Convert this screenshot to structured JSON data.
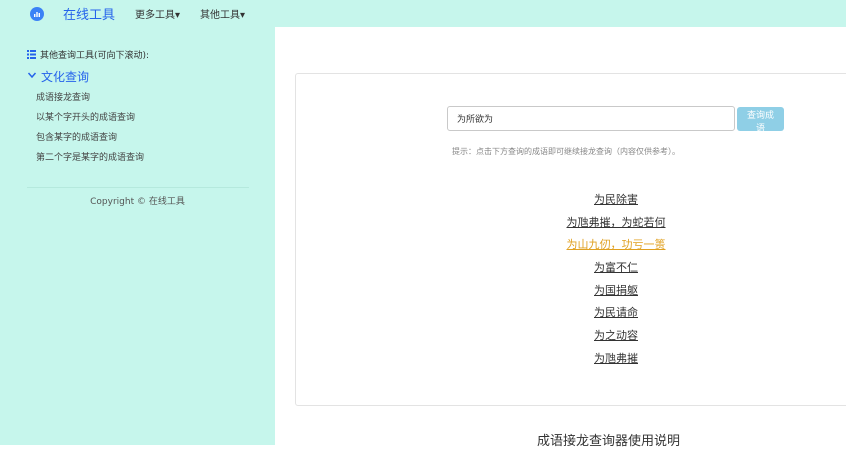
{
  "navbar": {
    "brand": "在线工具",
    "menu": [
      "更多工具▾",
      "其他工具▾"
    ]
  },
  "sidebar": {
    "header": "其他查询工具(可向下滚动):",
    "category": "文化查询",
    "links": [
      "成语接龙查询",
      "以某个字开头的成语查询",
      "包含某字的成语查询",
      "第二个字是某字的成语查询"
    ],
    "copyright": "Copyright © 在线工具"
  },
  "search": {
    "value": "为所欲为",
    "button_label": "查询成语"
  },
  "hint": "提示：点击下方查询的成语即可继续接龙查询（内容仅供参考）。",
  "results": [
    "为民除害",
    "为虺弗摧，为蛇若何",
    "为山九仞，功亏一篑",
    "为富不仁",
    "为国捐躯",
    "为民请命",
    "为之动容",
    "为虺弗摧"
  ],
  "section_title": "成语接龙查询器使用说明",
  "colors": {
    "background": "#c6f6ec",
    "brand": "#2563eb",
    "highlight": "#e0a020",
    "button": "#8fcfe6"
  }
}
